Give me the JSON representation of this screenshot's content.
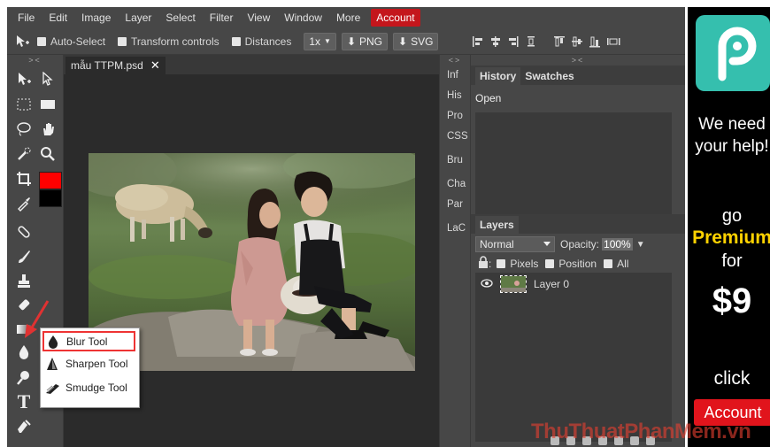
{
  "menubar": {
    "items": [
      "File",
      "Edit",
      "Image",
      "Layer",
      "Select",
      "Filter",
      "View",
      "Window",
      "More"
    ],
    "account": "Account"
  },
  "options": {
    "auto_select": "Auto-Select",
    "transform_controls": "Transform controls",
    "distances": "Distances",
    "zoom": "1x",
    "export_png": "PNG",
    "export_svg": "SVG"
  },
  "document": {
    "tab_title": "mẫu TTPM.psd",
    "close": "✕"
  },
  "tool_flyout": {
    "items": [
      "Blur Tool",
      "Sharpen Tool",
      "Smudge Tool"
    ],
    "selected": "Blur Tool"
  },
  "mini_panel": {
    "items": [
      "Inf",
      "His",
      "Pro",
      "CSS",
      "Bru",
      "Cha",
      "Par",
      "LaC"
    ]
  },
  "history": {
    "tabs": [
      "History",
      "Swatches"
    ],
    "entries": [
      "Open"
    ]
  },
  "layers": {
    "tab": "Layers",
    "blend_mode": "Normal",
    "opacity_label": "Opacity:",
    "opacity_value": "100%",
    "lock_label": ":",
    "lock_options": [
      "Pixels",
      "Position",
      "All"
    ],
    "items": [
      {
        "name": "Layer 0",
        "visible": true
      }
    ]
  },
  "ad": {
    "line1": "We need",
    "line2": "your help!",
    "go": "go",
    "premium": "Premium",
    "for": "for",
    "price": "$9",
    "click": "click",
    "account": "Account"
  },
  "watermark": "ThuThuatPhanMem.vn",
  "colors": {
    "foreground": "#ff0000",
    "background": "#000000",
    "accent_red": "#c4161c",
    "ad_teal": "#35bfae",
    "premium_yellow": "#ffd200"
  }
}
